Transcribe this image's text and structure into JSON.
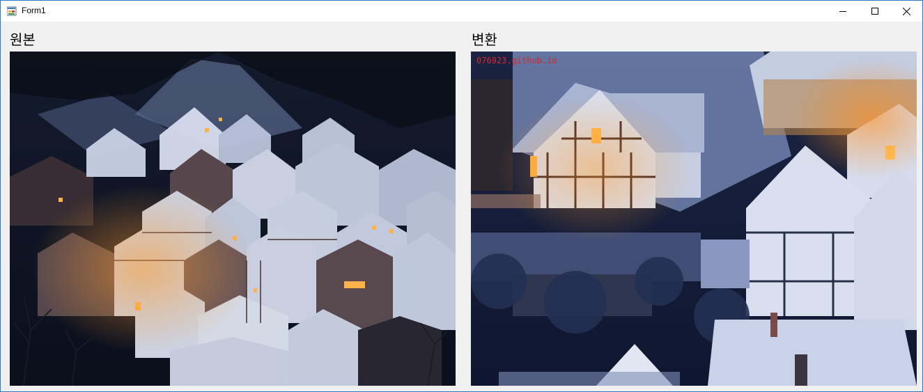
{
  "window": {
    "title": "Form1",
    "icons": {
      "app": "winforms-app-icon",
      "minimize": "minimize-icon",
      "maximize": "maximize-icon",
      "close": "close-icon"
    }
  },
  "labels": {
    "original": "원본",
    "converted": "변환"
  },
  "pictures": {
    "original": {
      "description_icon": "snowy-village-night-photo"
    },
    "converted": {
      "description_icon": "snowy-village-night-photo-zoomed",
      "watermark": "076923.github.io"
    }
  },
  "colors": {
    "titlebar_bg": "#ffffff",
    "client_bg": "#f0f0f0",
    "window_border": "#2b79c2",
    "watermark": "#d8282e"
  }
}
